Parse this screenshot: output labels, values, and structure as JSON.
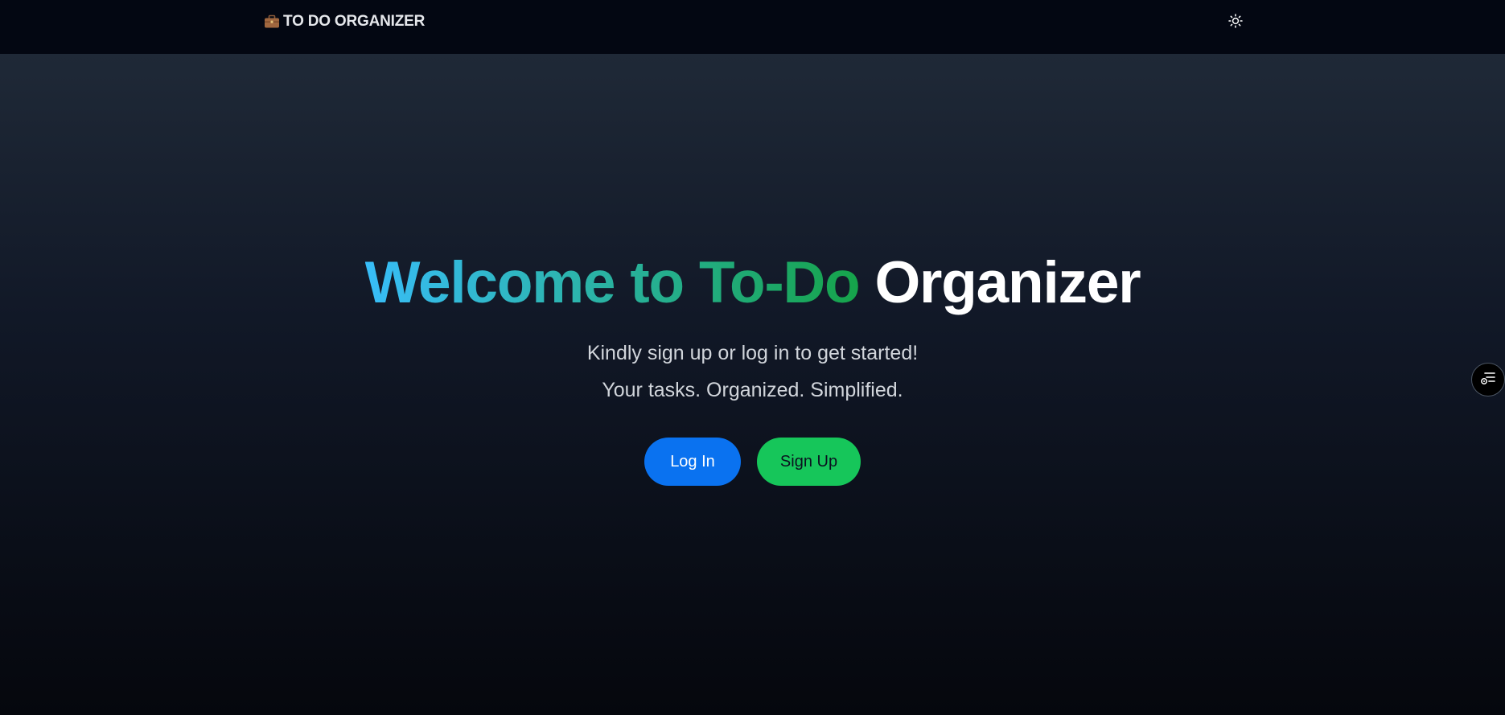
{
  "navbar": {
    "brand_icon": "briefcase-icon",
    "brand_label": "TO DO ORGANIZER",
    "theme_toggle_icon": "sun-icon"
  },
  "hero": {
    "headline_gradient": "Welcome to To-Do",
    "headline_plain": "Organizer",
    "subtitle_1": "Kindly sign up or log in to get started!",
    "subtitle_2": "Your tasks. Organized. Simplified."
  },
  "actions": {
    "login_label": "Log In",
    "signup_label": "Sign Up"
  },
  "floating": {
    "icon": "task-list-settings-icon"
  },
  "colors": {
    "nav_bg": "#030712",
    "gradient_start": "#38bdf8",
    "gradient_end": "#16a34a",
    "login_bg": "#0a72f0",
    "signup_bg": "#16c65a"
  }
}
